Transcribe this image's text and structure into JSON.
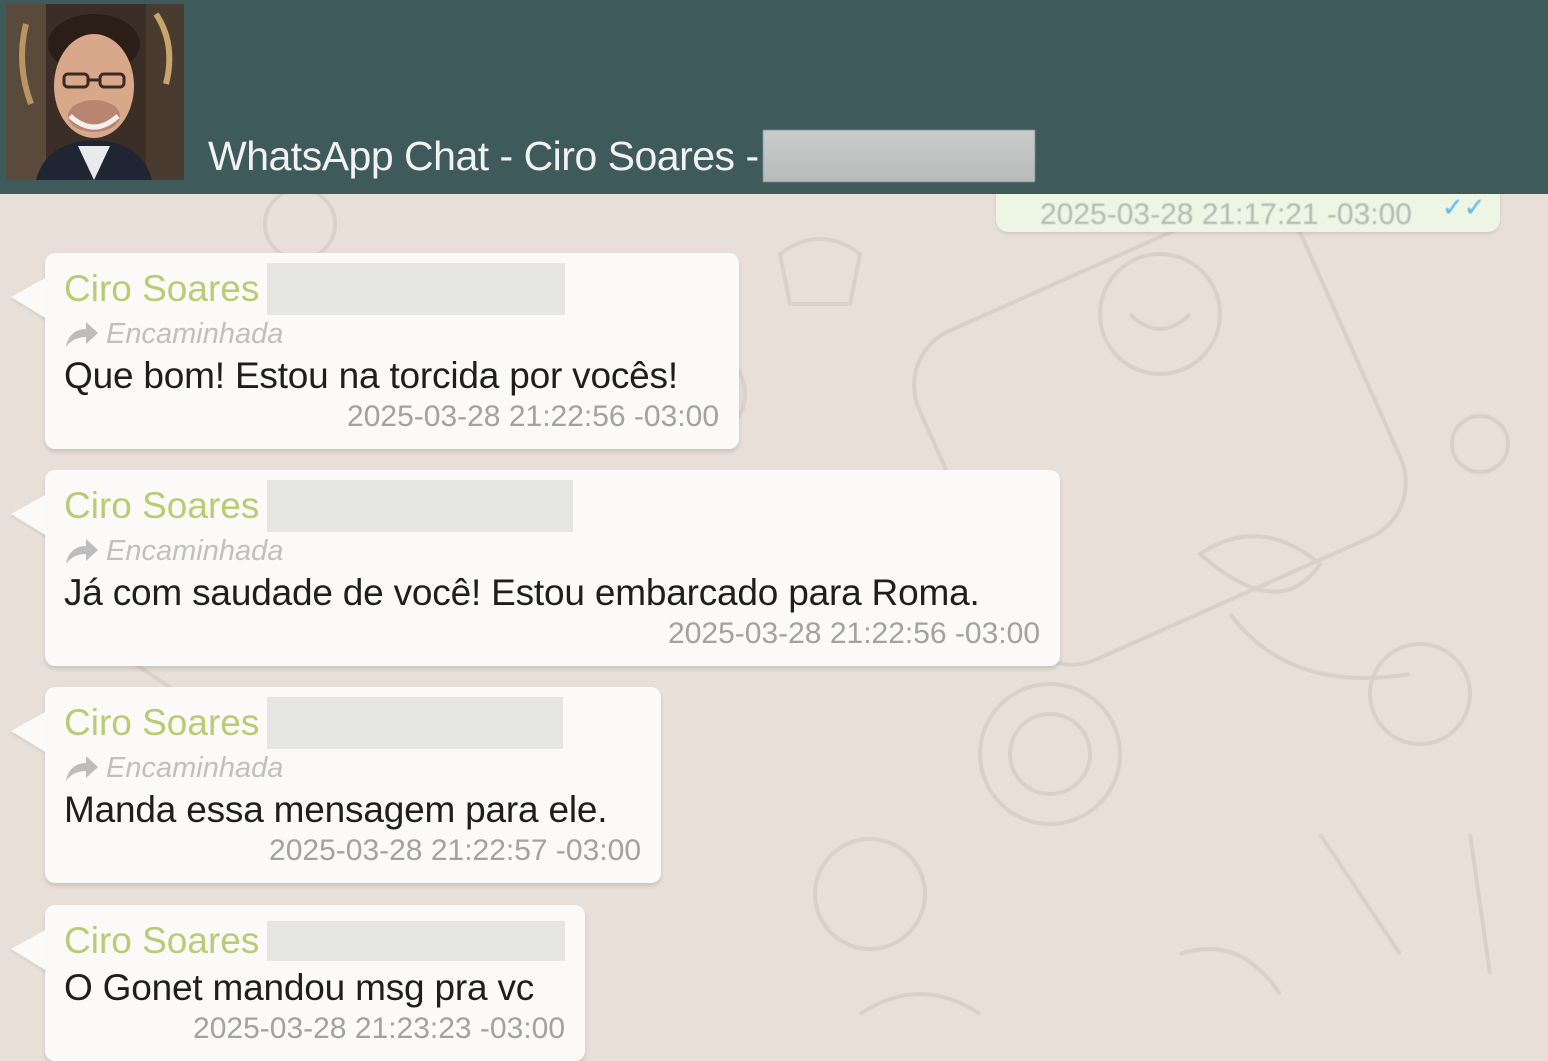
{
  "header": {
    "title": "WhatsApp Chat - Ciro Soares -",
    "avatar": "contact-avatar-photo"
  },
  "top_message": {
    "timestamp": "2025-03-28 21:17:21 -03:00",
    "status_icon": "double-check-icon"
  },
  "messages": [
    {
      "sender": "Ciro Soares",
      "forwarded_label": "Encaminhada",
      "text": "Que bom! Estou na torcida por vocês!",
      "timestamp": "2025-03-28 21:22:56 -03:00"
    },
    {
      "sender": "Ciro Soares",
      "forwarded_label": "Encaminhada",
      "text": "Já com saudade de você! Estou embarcado para Roma.",
      "timestamp": "2025-03-28 21:22:56 -03:00"
    },
    {
      "sender": "Ciro Soares",
      "forwarded_label": "Encaminhada",
      "text": "Manda essa mensagem para ele.",
      "timestamp": "2025-03-28 21:22:57 -03:00"
    },
    {
      "sender": "Ciro Soares",
      "text": "O Gonet mandou msg pra vc",
      "timestamp": "2025-03-28 21:23:23 -03:00"
    }
  ],
  "colors": {
    "header_bg": "#3e5a5b",
    "chat_bg": "#e7dfd8",
    "incoming_bubble": "#fbfaf8",
    "outgoing_bubble": "#edf5e4",
    "sender_name": "#b8cc74",
    "timestamp": "#a2a2a2"
  }
}
